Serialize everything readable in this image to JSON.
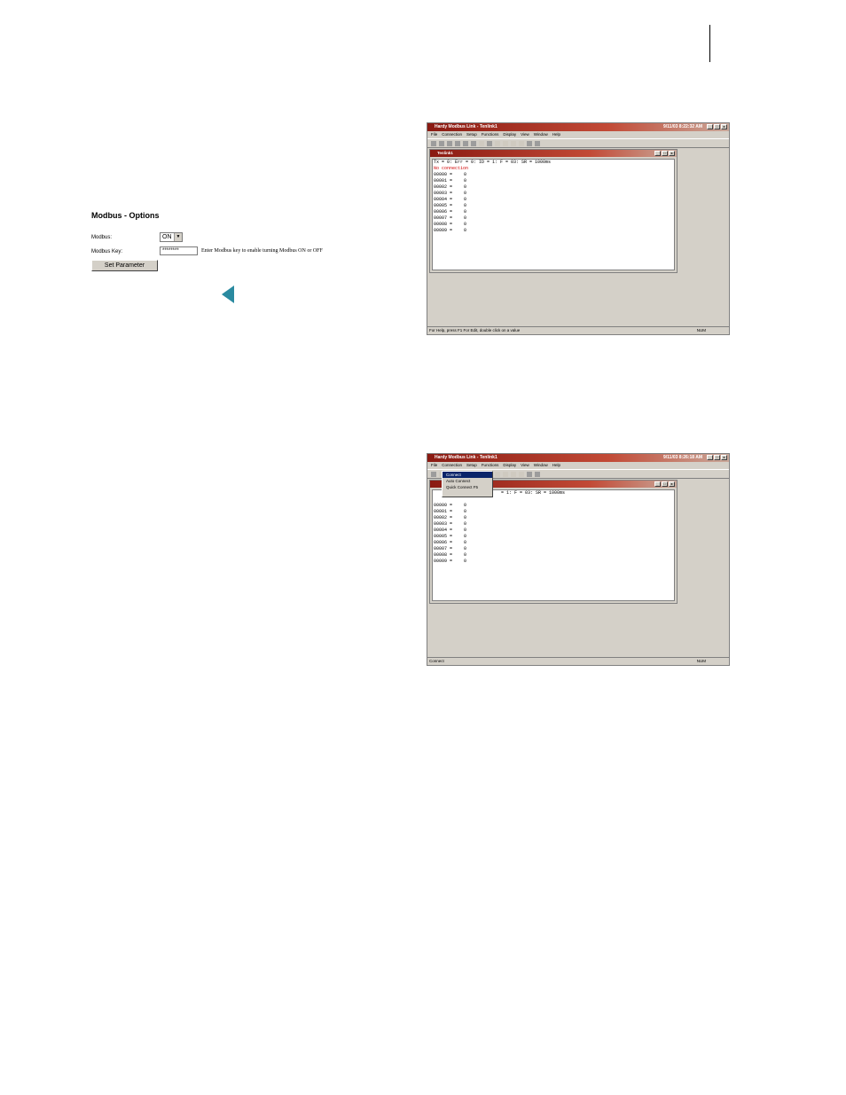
{
  "modbus_form": {
    "title": "Modbus - Options",
    "modbus_label": "Modbus:",
    "modbus_value": "ON",
    "key_label": "Modbus Key:",
    "key_value": "********",
    "hint": "Enter Modbus key to enable turning Modbus ON or OFF",
    "button_label": "Set Parameter"
  },
  "menus": [
    "File",
    "Connection",
    "Setup",
    "Functions",
    "Display",
    "View",
    "Window",
    "Help"
  ],
  "screen1": {
    "title": "Hardy Modbus Link - Tenlink1",
    "clock": "9/11/03 8:22:32 AM",
    "child_title": "Tenlink1",
    "info": "Tx = 0: Err = 0: ID = 1: F = 03: SR = 1000ms",
    "conn": "No connection",
    "status": "For Help, press F1   For Edit, double click on a value",
    "num": "NUM"
  },
  "screen2": {
    "title": "Hardy Modbus Link - Tenlink1",
    "clock": "9/11/03 8:26:18 AM",
    "info_tail": "= 1: F = 03: SR = 1000ms",
    "menu_items": [
      "Connect",
      "Auto Connect",
      "Quick Connect  F5"
    ],
    "status": "Connect",
    "num": "NUM"
  },
  "registers": [
    {
      "addr": "00000 =",
      "val": "0"
    },
    {
      "addr": "00001 =",
      "val": "0"
    },
    {
      "addr": "00002 =",
      "val": "0"
    },
    {
      "addr": "00003 =",
      "val": "0"
    },
    {
      "addr": "00004 =",
      "val": "0"
    },
    {
      "addr": "00005 =",
      "val": "0"
    },
    {
      "addr": "00006 =",
      "val": "0"
    },
    {
      "addr": "00007 =",
      "val": "0"
    },
    {
      "addr": "00008 =",
      "val": "0"
    },
    {
      "addr": "00009 =",
      "val": "0"
    }
  ]
}
